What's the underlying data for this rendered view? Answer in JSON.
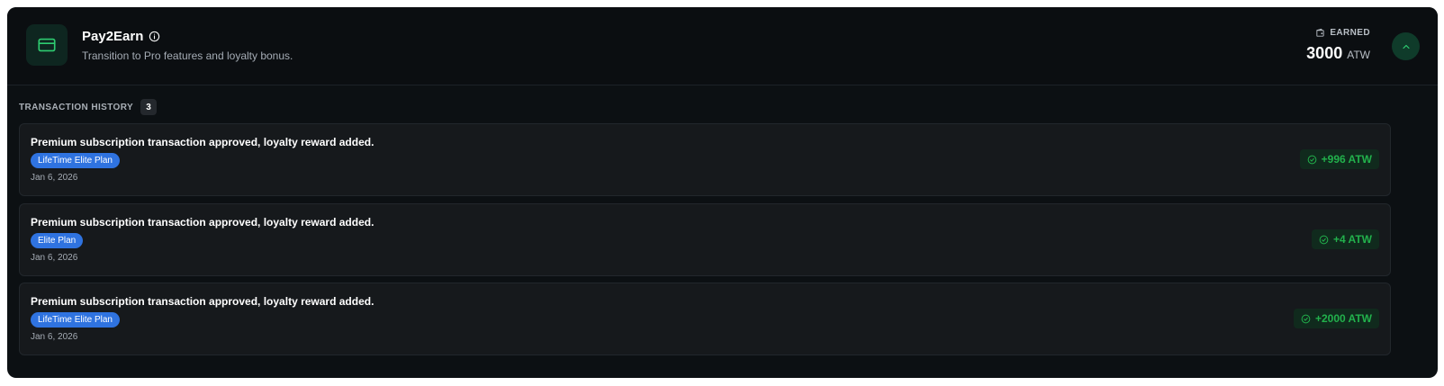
{
  "colors": {
    "accent": "#2ecc71",
    "plan_badge": "#2f73e0",
    "amount": "#22b14c"
  },
  "header": {
    "icon": "credit-card-icon",
    "title": "Pay2Earn",
    "info_icon": "info-icon",
    "subtitle": "Transition to Pro features and loyalty bonus.",
    "earned_label": "EARNED",
    "earned_icon": "wallet-icon",
    "earned_amount": "3000",
    "earned_unit": "ATW",
    "collapse_icon": "chevron-up-icon"
  },
  "history": {
    "title": "TRANSACTION HISTORY",
    "count": "3",
    "items": [
      {
        "description": "Premium subscription transaction approved, loyalty reward added.",
        "plan": "LifeTime Elite Plan",
        "date": "Jan 6, 2026",
        "amount": "+996 ATW",
        "status_icon": "check-circle-icon"
      },
      {
        "description": "Premium subscription transaction approved, loyalty reward added.",
        "plan": "Elite Plan",
        "date": "Jan 6, 2026",
        "amount": "+4 ATW",
        "status_icon": "check-circle-icon"
      },
      {
        "description": "Premium subscription transaction approved, loyalty reward added.",
        "plan": "LifeTime Elite Plan",
        "date": "Jan 6, 2026",
        "amount": "+2000 ATW",
        "status_icon": "check-circle-icon"
      }
    ]
  }
}
